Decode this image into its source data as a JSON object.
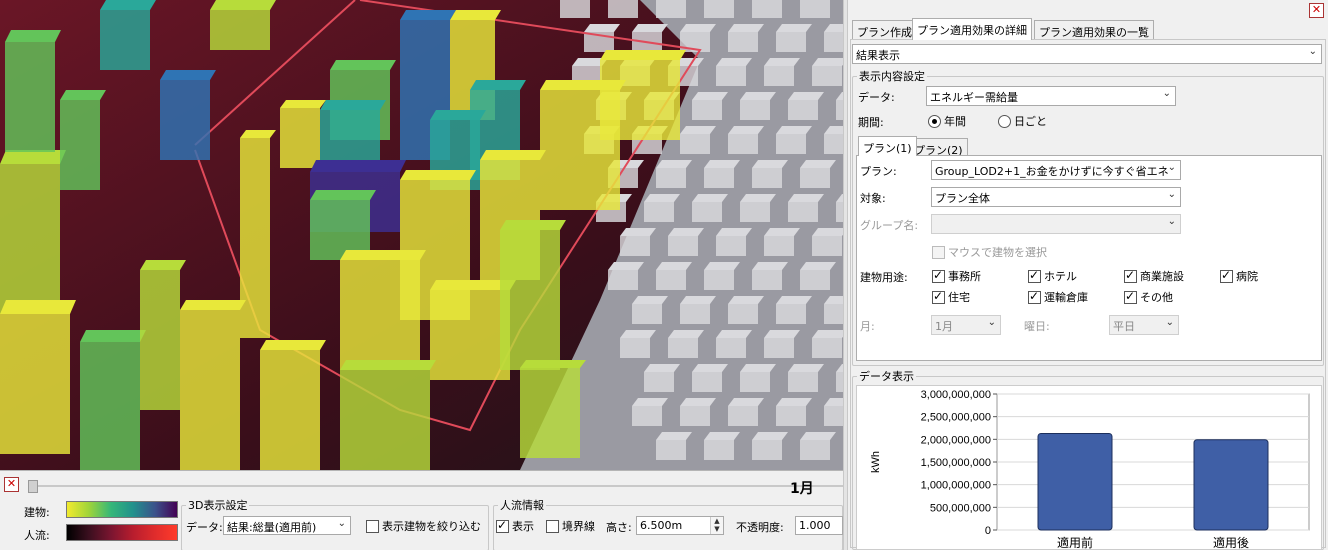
{
  "viewport": {
    "colors": {
      "ground": "#5a1220",
      "ground_dark": "#24141c",
      "highlight_line": "#e04a5a",
      "gray_building": "#d9d9dd",
      "yellow": "#e8e83a",
      "yellow_green": "#b7dc3a",
      "green": "#63c45a",
      "teal": "#2aa89a",
      "blue": "#2f74b4",
      "purple": "#3d2f93"
    }
  },
  "timeline": {
    "month_label": "1月",
    "position_fraction": 0
  },
  "legend": {
    "building_label": "建物:",
    "flow_label": "人流:",
    "building_gradient": [
      "#f2ea2e",
      "#9fd43a",
      "#35b779",
      "#21918c",
      "#3b528b",
      "#440154"
    ],
    "flow_gradient": [
      "#000000",
      "#3b0f1f",
      "#7a1530",
      "#b81d2e",
      "#e02c2c",
      "#ff3b2a"
    ]
  },
  "display_settings_3d": {
    "group_title": "3D表示設定",
    "data_label": "データ:",
    "data_value": "結果:総量(適用前)",
    "filter_checkbox_label": "表示建物を絞り込む",
    "filter_checked": false
  },
  "people_flow": {
    "group_title": "人流情報",
    "show_label": "表示",
    "show_checked": true,
    "boundary_label": "境界線",
    "boundary_checked": false,
    "height_label": "高さ:",
    "height_value": "6.500m",
    "opacity_label": "不透明度:",
    "opacity_value": "1.000"
  },
  "right_panel": {
    "tabs": [
      "プラン作成",
      "プラン適用効果の詳細",
      "プラン適用効果の一覧"
    ],
    "active_tab": 1,
    "result_select": "結果表示",
    "content_settings": {
      "title": "表示内容設定",
      "data_label": "データ:",
      "data_value": "エネルギー需給量",
      "period_label": "期間:",
      "period_options": [
        "年間",
        "日ごと"
      ],
      "period_selected": 0,
      "plan_tabs": [
        "プラン(1)",
        "プラン(2)"
      ],
      "plan_label": "プラン:",
      "plan_value": "Group_LOD2+1_お金をかけずに今すぐ省エネ",
      "target_label": "対象:",
      "target_value": "プラン全体",
      "group_label": "グループ名:",
      "group_value": "",
      "mouse_select_label": "マウスで建物を選択",
      "usage_label": "建物用途:",
      "usages": [
        {
          "label": "事務所",
          "checked": true
        },
        {
          "label": "ホテル",
          "checked": true
        },
        {
          "label": "商業施設",
          "checked": true
        },
        {
          "label": "病院",
          "checked": true
        },
        {
          "label": "住宅",
          "checked": true
        },
        {
          "label": "運輸倉庫",
          "checked": true
        },
        {
          "label": "その他",
          "checked": true
        }
      ],
      "month_label": "月:",
      "month_value": "1月",
      "weekday_label": "曜日:",
      "weekday_value": "平日"
    },
    "data_display": {
      "title": "データ表示"
    }
  },
  "chart_data": {
    "type": "bar",
    "categories": [
      "適用前",
      "適用後"
    ],
    "values": [
      2130000000,
      1990000000
    ],
    "ylabel": "kWh",
    "ylim": [
      0,
      3000000000
    ],
    "yticks": [
      "3,000,000,000",
      "2,500,000,000",
      "2,000,000,000",
      "1,500,000,000",
      "1,000,000,000",
      "500,000,000",
      "0"
    ],
    "ytick_values": [
      3000000000,
      2500000000,
      2000000000,
      1500000000,
      1000000000,
      500000000,
      0
    ],
    "bar_color": "#3f5fa6",
    "grid": true
  }
}
